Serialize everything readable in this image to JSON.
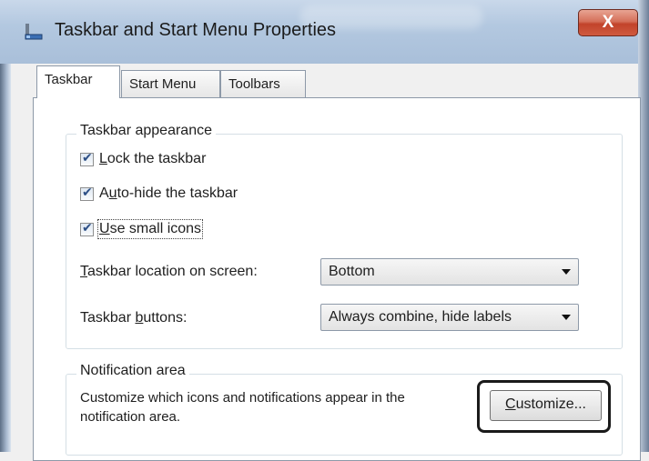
{
  "window": {
    "title": "Taskbar and Start Menu Properties",
    "close_label": "X",
    "accent": "#c2432b"
  },
  "tabs": [
    {
      "label": "Taskbar",
      "active": true
    },
    {
      "label": "Start Menu",
      "active": false
    },
    {
      "label": "Toolbars",
      "active": false
    }
  ],
  "taskbar_appearance": {
    "legend": "Taskbar appearance",
    "checkboxes": [
      {
        "pre": "",
        "key": "L",
        "post": "ock the taskbar",
        "checked": true
      },
      {
        "pre": "A",
        "key": "u",
        "post": "to-hide the taskbar",
        "checked": true
      },
      {
        "pre": "",
        "key": "U",
        "post": "se small icons",
        "checked": true
      }
    ],
    "location": {
      "key": "T",
      "label_rest": "askbar location on screen:",
      "value": "Bottom"
    },
    "buttons": {
      "pre": "Taskbar ",
      "key": "b",
      "label_rest": "uttons:",
      "value": "Always combine, hide labels"
    }
  },
  "notification_area": {
    "legend": "Notification area",
    "description_line1": "Customize which icons and notifications appear in the",
    "description_line2": "notification area.",
    "customize_key": "C",
    "customize_rest": "ustomize..."
  }
}
